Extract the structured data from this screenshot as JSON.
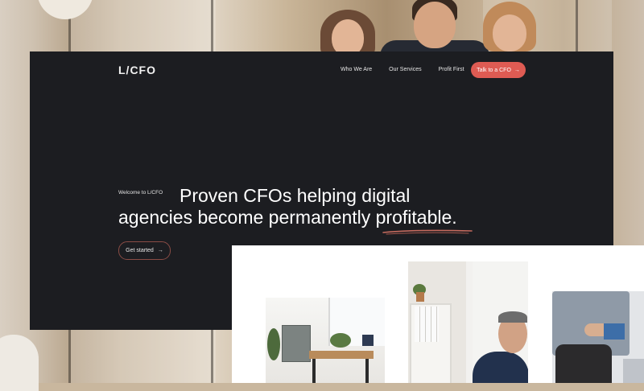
{
  "site": {
    "logo": "L/CFO",
    "nav": [
      "Who We Are",
      "Our Services",
      "Profit First"
    ],
    "cta_label": "Talk to a CFO",
    "cta_arrow": "→",
    "welcome": "Welcome to L/CFO",
    "headline_main": "Proven CFOs helping digital agencies become permanently ",
    "headline_emphasis": "profitable",
    "headline_end": ".",
    "get_started_label": "Get started",
    "get_started_arrow": "→"
  },
  "colors": {
    "panel_bg": "#1c1d21",
    "accent": "#de5b53",
    "white_panel": "#ffffff"
  },
  "icons": {
    "cta_arrow": "arrow-right-icon",
    "get_started_arrow": "arrow-right-icon"
  }
}
